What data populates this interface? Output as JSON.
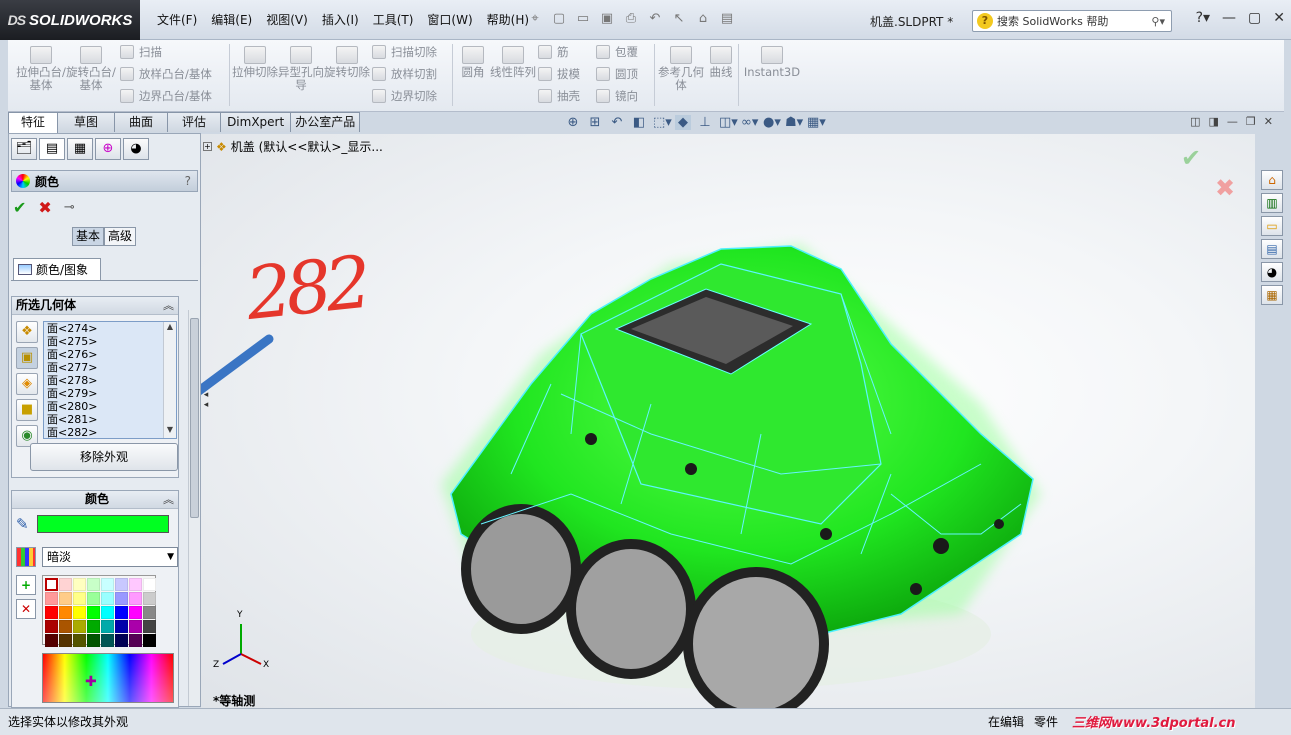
{
  "app": {
    "brand": "SOLIDWORKS",
    "brand_prefix": "DS",
    "document_title": "机盖.SLDPRT *"
  },
  "menu": [
    "文件(F)",
    "编辑(E)",
    "视图(V)",
    "插入(I)",
    "工具(T)",
    "窗口(W)",
    "帮助(H)"
  ],
  "help_search": {
    "placeholder": "搜索 SolidWorks 帮助"
  },
  "command_manager": {
    "big_buttons": [
      "拉伸凸台/基体",
      "旋转凸台/基体",
      "拉伸切除",
      "异型孔向导",
      "旋转切除",
      "圆角",
      "线性阵列",
      "参考几何体",
      "曲线",
      "Instant3D"
    ],
    "small_buttons": [
      "扫描",
      "放样凸台/基体",
      "边界凸台/基体",
      "扫描切除",
      "放样切割",
      "边界切除",
      "筋",
      "拔模",
      "抽壳",
      "包覆",
      "圆顶",
      "镜向"
    ]
  },
  "tabs": [
    "特征",
    "草图",
    "曲面",
    "评估",
    "DimXpert",
    "办公室产品"
  ],
  "active_tab": "特征",
  "panel": {
    "title": "颜色",
    "help": "?",
    "mode_basic": "基本",
    "mode_advanced": "高级",
    "subtab": "颜色/图象",
    "selected_geometry": {
      "header": "所选几何体",
      "faces": [
        "面<274>",
        "面<275>",
        "面<276>",
        "面<277>",
        "面<278>",
        "面<279>",
        "面<280>",
        "面<281>",
        "面<282>"
      ],
      "remove_button": "移除外观"
    },
    "color": {
      "header": "颜色",
      "current": "#00ff21",
      "shading": "暗淡",
      "palette": [
        "#ffffff",
        "#ffd3d3",
        "#ffffc0",
        "#c8ffc8",
        "#c8ffff",
        "#c8c8ff",
        "#ffc8ff",
        "#ffffff",
        "#ff9999",
        "#ffcc88",
        "#ffff88",
        "#99ff99",
        "#99ffff",
        "#9999ff",
        "#ff99ff",
        "#cccccc",
        "#ff0000",
        "#ff8800",
        "#ffff00",
        "#00ff00",
        "#00ffff",
        "#0000ff",
        "#ff00ff",
        "#888888",
        "#aa0000",
        "#aa5500",
        "#aaaa00",
        "#00aa00",
        "#00aaaa",
        "#0000aa",
        "#aa00aa",
        "#444444",
        "#550000",
        "#553300",
        "#555500",
        "#005500",
        "#005555",
        "#000055",
        "#550055",
        "#000000"
      ]
    }
  },
  "viewport": {
    "tree_label": "机盖 (默认<<默认>_显示...",
    "annotation": "282",
    "view_name": "*等轴测",
    "axes": {
      "x": "X",
      "y": "Y",
      "z": "Z"
    }
  },
  "status": {
    "left": "选择实体以修改其外观",
    "mode": "在编辑",
    "type": "零件",
    "watermark": "三维网www.3dportal.cn"
  }
}
